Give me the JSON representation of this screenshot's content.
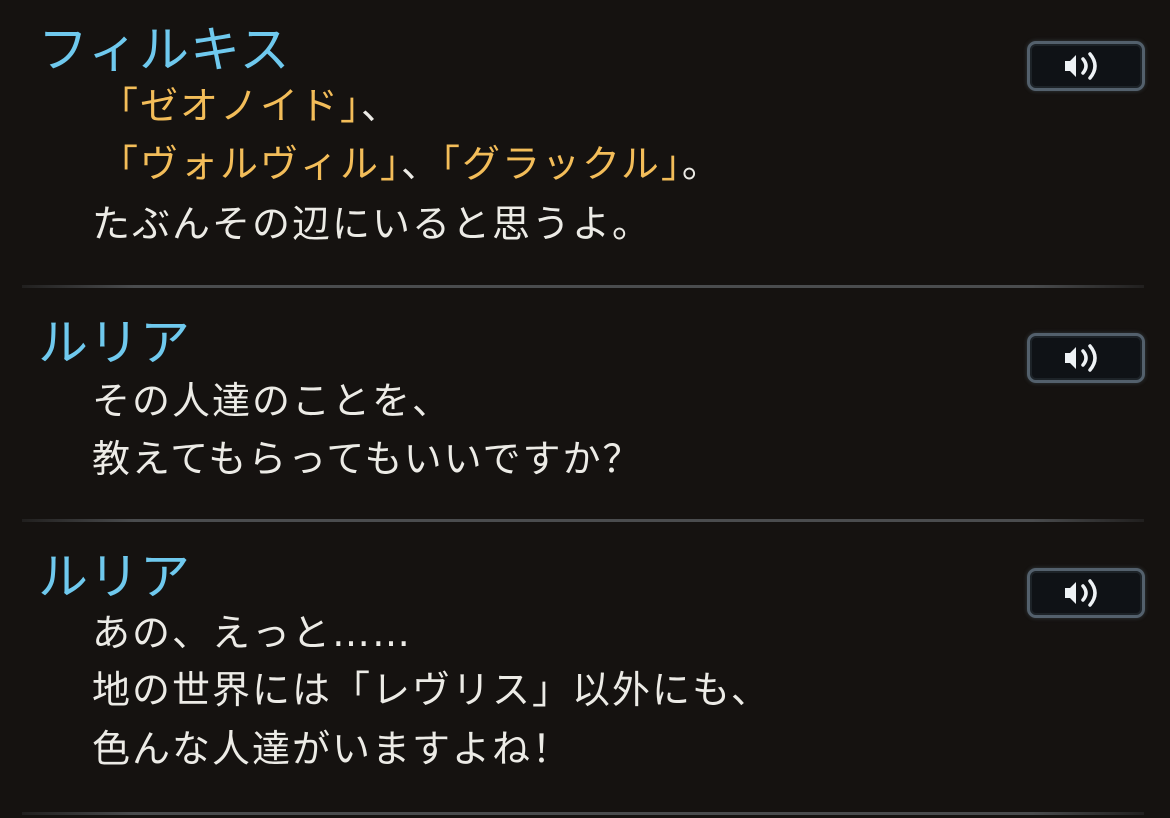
{
  "entries": [
    {
      "speaker": "フィルキス",
      "lines": [
        [
          {
            "text": "「ゼオノイド」",
            "hl": true
          },
          {
            "text": "、",
            "hl": false
          }
        ],
        [
          {
            "text": "「ヴォルヴィル」",
            "hl": true
          },
          {
            "text": "、",
            "hl": false
          },
          {
            "text": "「グラックル」",
            "hl": true
          },
          {
            "text": "。",
            "hl": false
          }
        ],
        [
          {
            "text": "たぶんその辺にいると思うよ。",
            "hl": false
          }
        ]
      ]
    },
    {
      "speaker": "ルリア",
      "lines": [
        [
          {
            "text": "その人達のことを、",
            "hl": false
          }
        ],
        [
          {
            "text": "教えてもらってもいいですか？",
            "hl": false
          }
        ]
      ]
    },
    {
      "speaker": "ルリア",
      "lines": [
        [
          {
            "text": "あの、えっと……",
            "hl": false
          }
        ],
        [
          {
            "text": "地の世界には「レヴリス」以外にも、",
            "hl": false
          }
        ],
        [
          {
            "text": "色んな人達がいますよね！",
            "hl": false
          }
        ]
      ]
    }
  ],
  "voice_button": {
    "icon": "speaker-voice-icon"
  },
  "colors": {
    "background": "#151210",
    "speaker": "#6fc9ee",
    "text": "#ecebe6",
    "highlight": "#f3bd59",
    "button_border": "#53606c"
  }
}
